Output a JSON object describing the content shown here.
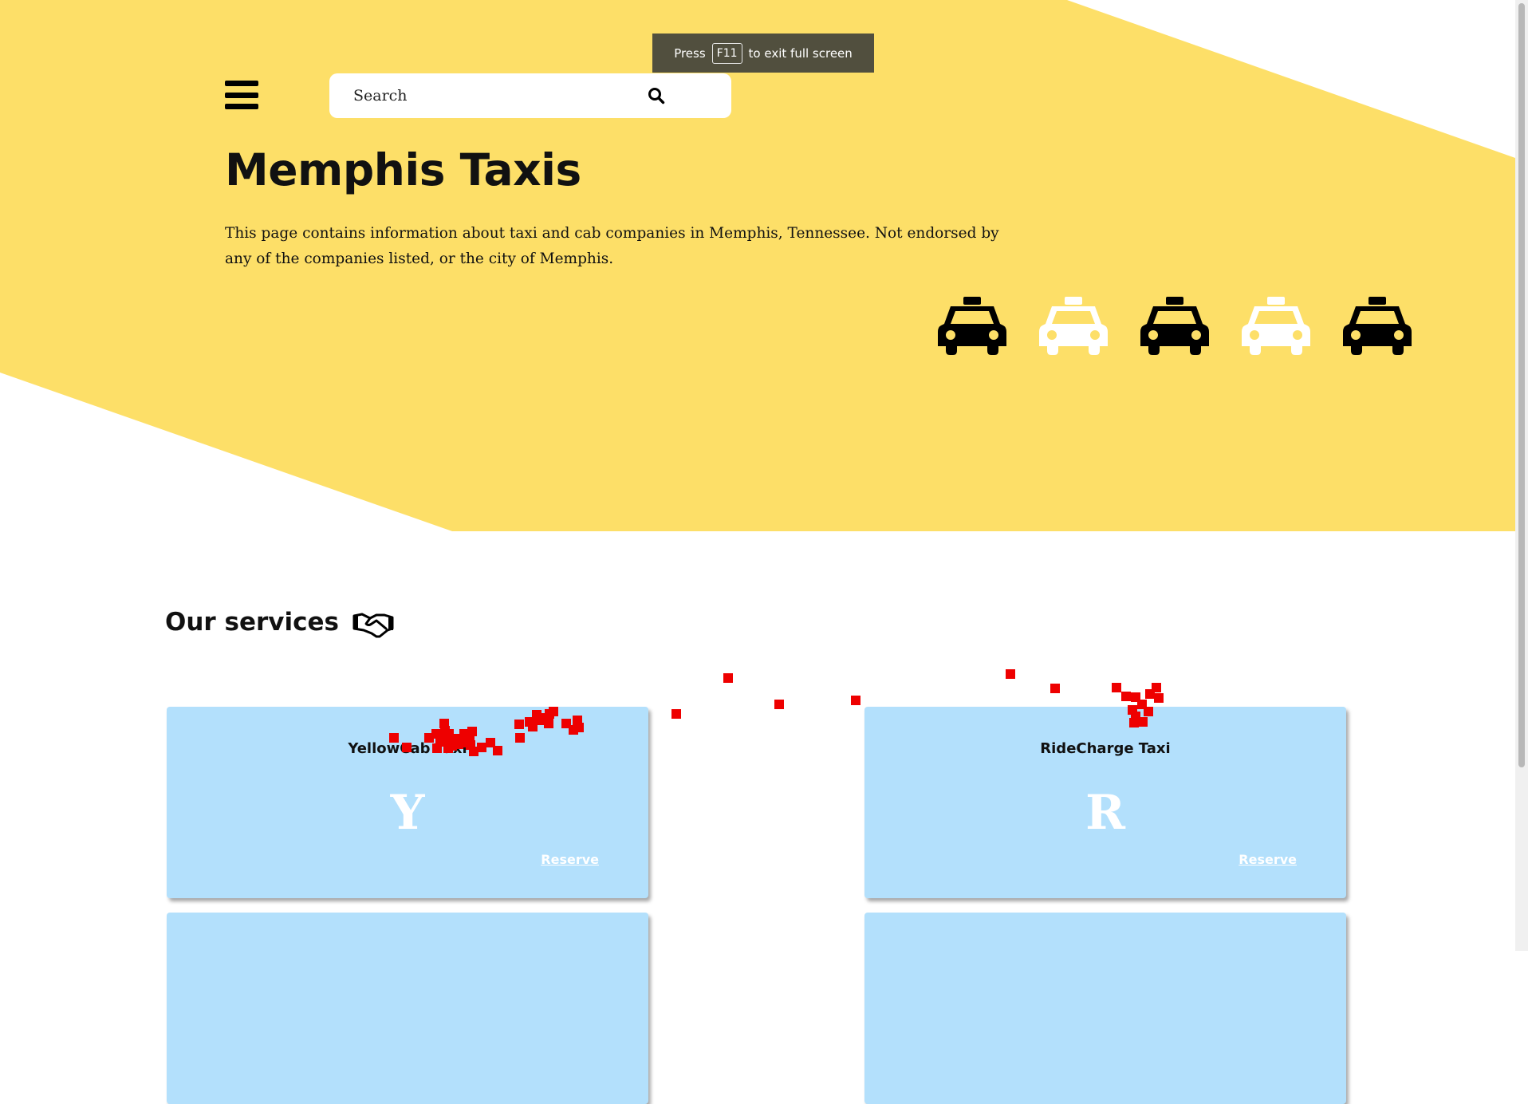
{
  "browser": {
    "fullscreen_toast": {
      "prefix": "Press",
      "key": "F11",
      "suffix": "to exit full screen"
    }
  },
  "header": {
    "menu_icon": "hamburger-menu-icon",
    "search": {
      "placeholder": "Search",
      "value": "",
      "icon": "search-icon"
    }
  },
  "hero": {
    "title": "Memphis Taxis",
    "description": "This page contains information about taxi and cab companies in Memphis, Tennessee. Not endorsed by any of the companies listed, or the city of Memphis.",
    "taxi_icons": [
      "black",
      "white",
      "black",
      "white",
      "black"
    ]
  },
  "services": {
    "heading": "Our services",
    "icon": "handshake-icon",
    "cards": [
      {
        "name": "YellowCab Taxi",
        "letter": "Y",
        "link": "Reserve"
      },
      {
        "name": "RideCharge Taxi",
        "letter": "R",
        "link": "Reserve"
      },
      {
        "name": "",
        "letter": "",
        "link": ""
      },
      {
        "name": "",
        "letter": "",
        "link": ""
      }
    ]
  },
  "colors": {
    "hero_yellow": "#fddf68",
    "card_blue": "#b3e0fc",
    "marker_red": "#ee0000",
    "toast_bg": "#514f3e"
  }
}
